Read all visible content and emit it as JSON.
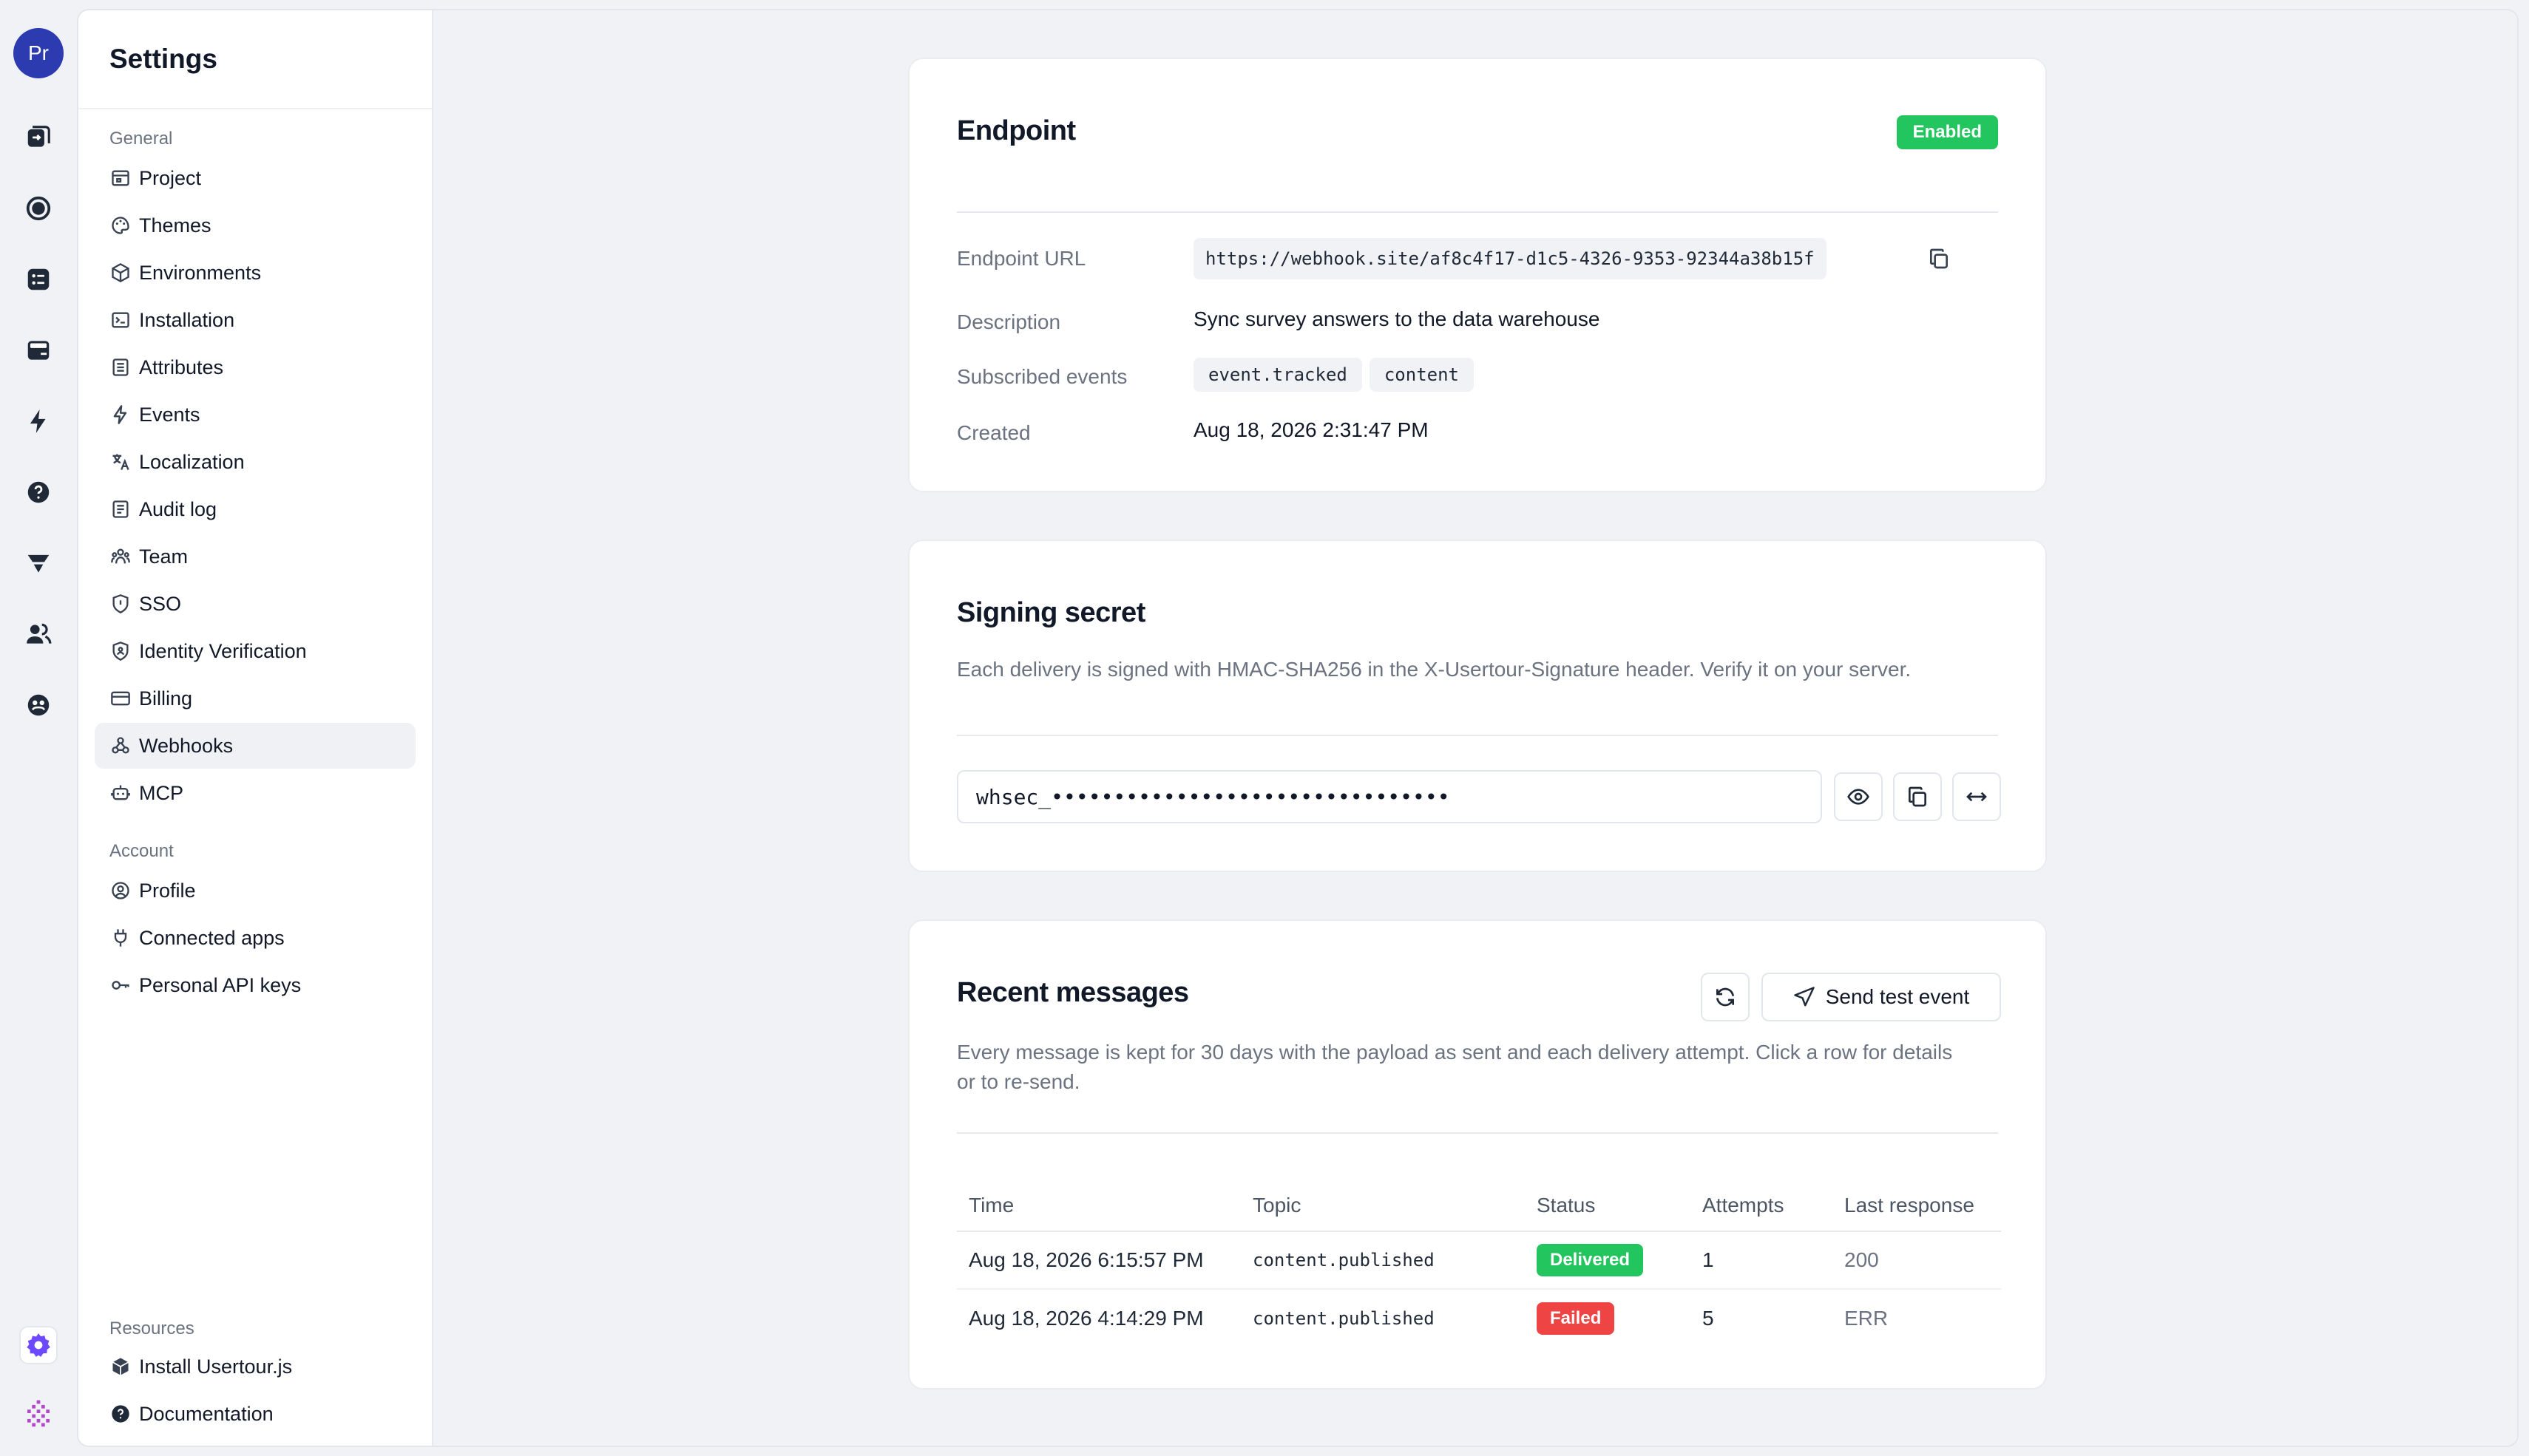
{
  "rail": {
    "avatar_initials": "Pr"
  },
  "sidebar": {
    "title": "Settings",
    "general_label": "General",
    "general_items": [
      {
        "label": "Project",
        "icon": "project-icon"
      },
      {
        "label": "Themes",
        "icon": "palette-icon"
      },
      {
        "label": "Environments",
        "icon": "cube-icon"
      },
      {
        "label": "Installation",
        "icon": "terminal-icon"
      },
      {
        "label": "Attributes",
        "icon": "list-icon"
      },
      {
        "label": "Events",
        "icon": "bolt-icon"
      },
      {
        "label": "Localization",
        "icon": "translate-icon"
      },
      {
        "label": "Audit log",
        "icon": "log-icon"
      },
      {
        "label": "Team",
        "icon": "team-icon"
      },
      {
        "label": "SSO",
        "icon": "shield-icon"
      },
      {
        "label": "Identity Verification",
        "icon": "shield-check-icon"
      },
      {
        "label": "Billing",
        "icon": "card-icon"
      },
      {
        "label": "Webhooks",
        "icon": "webhook-icon"
      },
      {
        "label": "MCP",
        "icon": "robot-icon"
      }
    ],
    "account_label": "Account",
    "account_items": [
      {
        "label": "Profile",
        "icon": "user-circle-icon"
      },
      {
        "label": "Connected apps",
        "icon": "plug-icon"
      },
      {
        "label": "Personal API keys",
        "icon": "key-icon"
      }
    ],
    "resources_label": "Resources",
    "resources_items": [
      {
        "label": "Install Usertour.js",
        "icon": "package-icon"
      },
      {
        "label": "Documentation",
        "icon": "help-icon"
      }
    ]
  },
  "endpoint": {
    "title": "Endpoint",
    "status": "Enabled",
    "url_label": "Endpoint URL",
    "url": "https://webhook.site/af8c4f17-d1c5-4326-9353-92344a38b15f",
    "description_label": "Description",
    "description": "Sync survey answers to the data warehouse",
    "events_label": "Subscribed events",
    "events": [
      "event.tracked",
      "content"
    ],
    "created_label": "Created",
    "created": "Aug 18, 2026 2:31:47 PM"
  },
  "secret": {
    "title": "Signing secret",
    "description": "Each delivery is signed with HMAC-SHA256 in the X-Usertour-Signature header. Verify it on your server.",
    "value": "whsec_••••••••••••••••••••••••••••••••"
  },
  "messages": {
    "title": "Recent messages",
    "send_test_label": "Send test event",
    "description_line1": "Every message is kept for 30 days with the payload as sent and each delivery attempt. Click a row for details",
    "description_line2": "or to re-send.",
    "columns": [
      "Time",
      "Topic",
      "Status",
      "Attempts",
      "Last response"
    ],
    "rows": [
      {
        "time": "Aug 18, 2026 6:15:57 PM",
        "topic": "content.published",
        "status": "Delivered",
        "attempts": "1",
        "response": "200"
      },
      {
        "time": "Aug 18, 2026 4:14:29 PM",
        "topic": "content.published",
        "status": "Failed",
        "attempts": "5",
        "response": "ERR"
      }
    ]
  },
  "colors": {
    "accent": "#2d3bb0",
    "success": "#22c55e",
    "danger": "#ef4444",
    "active_rail": "#6d4aff"
  }
}
